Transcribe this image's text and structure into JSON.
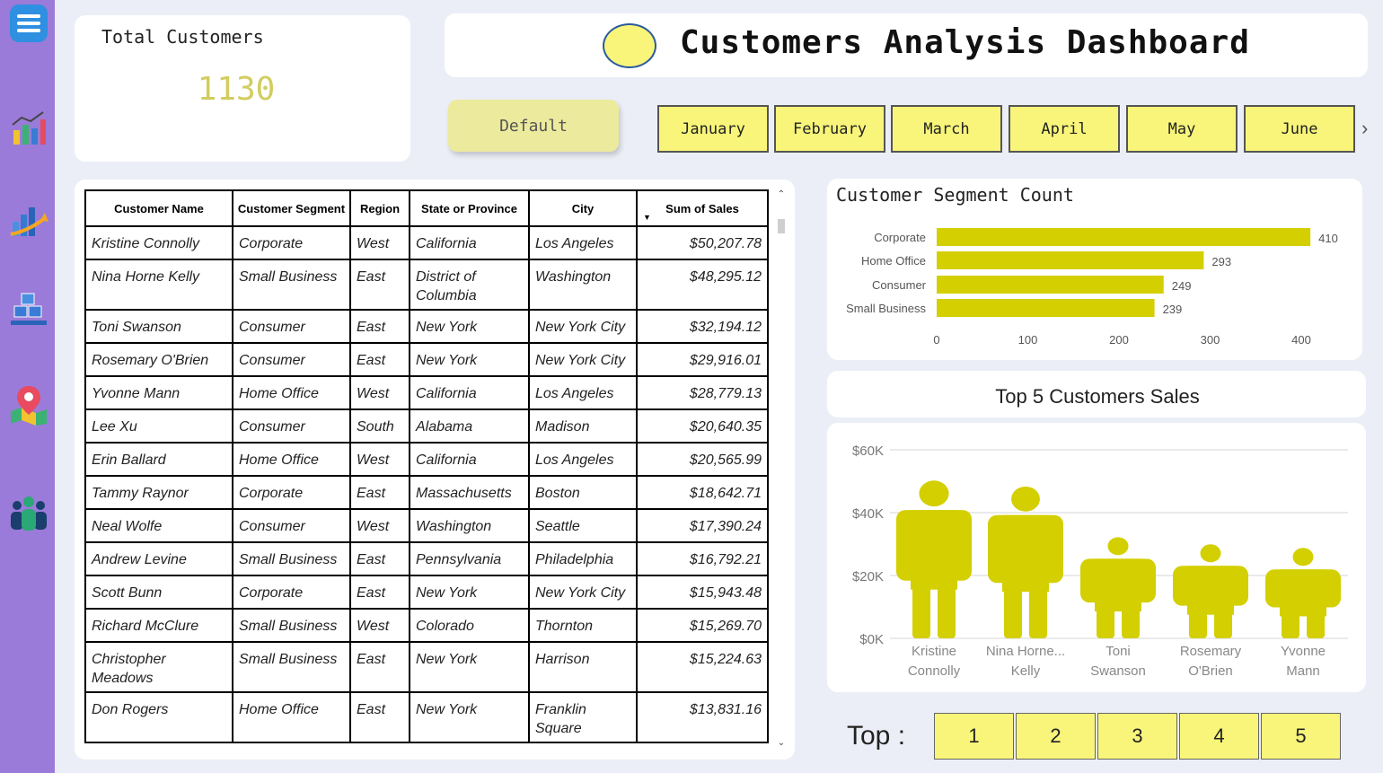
{
  "sidebar": {
    "items": [
      {
        "icon": "menu-icon"
      },
      {
        "icon": "sales-chart-icon"
      },
      {
        "icon": "growth-chart-icon"
      },
      {
        "icon": "products-boxes-icon"
      },
      {
        "icon": "map-pin-icon"
      },
      {
        "icon": "customers-group-icon"
      }
    ]
  },
  "kpi": {
    "label": "Total Customers",
    "value": "1130"
  },
  "header": {
    "title": "Customers Analysis Dashboard"
  },
  "filters": {
    "default_label": "Default",
    "months": [
      "January",
      "February",
      "March",
      "April",
      "May",
      "June"
    ],
    "next_icon": "chevron-right-icon"
  },
  "table": {
    "columns": [
      "Customer Name",
      "Customer Segment",
      "Region",
      "State or Province",
      "City",
      "Sum of Sales"
    ],
    "rows": [
      [
        "Kristine Connolly",
        "Corporate",
        "West",
        "California",
        "Los Angeles",
        "$50,207.78"
      ],
      [
        "Nina Horne Kelly",
        "Small Business",
        "East",
        "District of Columbia",
        "Washington",
        "$48,295.12"
      ],
      [
        "Toni Swanson",
        "Consumer",
        "East",
        "New York",
        "New York City",
        "$32,194.12"
      ],
      [
        "Rosemary O'Brien",
        "Consumer",
        "East",
        "New York",
        "New York City",
        "$29,916.01"
      ],
      [
        "Yvonne Mann",
        "Home Office",
        "West",
        "California",
        "Los Angeles",
        "$28,779.13"
      ],
      [
        "Lee Xu",
        "Consumer",
        "South",
        "Alabama",
        "Madison",
        "$20,640.35"
      ],
      [
        "Erin Ballard",
        "Home Office",
        "West",
        "California",
        "Los Angeles",
        "$20,565.99"
      ],
      [
        "Tammy Raynor",
        "Corporate",
        "East",
        "Massachusetts",
        "Boston",
        "$18,642.71"
      ],
      [
        "Neal Wolfe",
        "Consumer",
        "West",
        "Washington",
        "Seattle",
        "$17,390.24"
      ],
      [
        "Andrew Levine",
        "Small Business",
        "East",
        "Pennsylvania",
        "Philadelphia",
        "$16,792.21"
      ],
      [
        "Scott Bunn",
        "Corporate",
        "East",
        "New York",
        "New York City",
        "$15,943.48"
      ],
      [
        "Richard McClure",
        "Small Business",
        "West",
        "Colorado",
        "Thornton",
        "$15,269.70"
      ],
      [
        "Christopher Meadows",
        "Small Business",
        "East",
        "New York",
        "Harrison",
        "$15,224.63"
      ],
      [
        "Don Rogers",
        "Home Office",
        "East",
        "New York",
        "Franklin Square",
        "$13,831.16"
      ]
    ]
  },
  "colors": {
    "accent": "#d4cf00",
    "button": "#f8f57a",
    "sidebar": "#9b7bd9",
    "background": "#eceef7"
  },
  "chart_data": [
    {
      "type": "bar",
      "orientation": "horizontal",
      "title": "Customer Segment Count",
      "categories": [
        "Corporate",
        "Home Office",
        "Consumer",
        "Small Business"
      ],
      "values": [
        410,
        293,
        249,
        239
      ],
      "xlim": [
        0,
        410
      ],
      "xticks": [
        0,
        100,
        200,
        300,
        400
      ],
      "grid": false
    },
    {
      "type": "bar",
      "title": "Top 5 Customers Sales",
      "categories": [
        "Kristine Connolly",
        "Nina Horne... Kelly",
        "Toni Swanson",
        "Rosemary O'Brien",
        "Yvonne Mann"
      ],
      "category_lines": [
        [
          "Kristine",
          "Connolly"
        ],
        [
          "Nina Horne...",
          "Kelly"
        ],
        [
          "Toni",
          "Swanson"
        ],
        [
          "Rosemary",
          "O'Brien"
        ],
        [
          "Yvonne",
          "Mann"
        ]
      ],
      "values": [
        50207.78,
        48295.12,
        32194.12,
        29916.01,
        28779.13
      ],
      "ylim": [
        0,
        60000
      ],
      "yticks": [
        "$0K",
        "$20K",
        "$40K",
        "$60K"
      ],
      "marker": "person-icon",
      "grid": true
    }
  ],
  "topn": {
    "label": "Top :",
    "options": [
      "1",
      "2",
      "3",
      "4",
      "5"
    ]
  }
}
